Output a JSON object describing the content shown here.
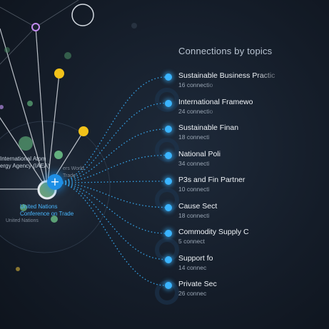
{
  "panel": {
    "title": "Connections by topics"
  },
  "topics": [
    {
      "label": "Sustainable Business Practic",
      "count": "16 connectio"
    },
    {
      "label": "International Framewo",
      "count": "24 connectio"
    },
    {
      "label": "Sustainable Finan",
      "count": "18 connecti"
    },
    {
      "label": "National Poli",
      "count": "34 connecti"
    },
    {
      "label": "P3s and Fin Partner",
      "count": "10 connecti"
    },
    {
      "label": "Cause Sect",
      "count": "18 connecti"
    },
    {
      "label": "Commodity Supply C",
      "count": "5 connect"
    },
    {
      "label": "Support fo",
      "count": "14 connec"
    },
    {
      "label": "Private Sec",
      "count": "26 connec"
    }
  ],
  "graph": {
    "hub_button": "+",
    "node_labels": {
      "iaea": "International Atom\nergy Agency (IAEA)",
      "world_trade": "ers World\nTrade",
      "unctad": "United Nations\nConference on Trade",
      "un": "United Nations"
    }
  },
  "colors": {
    "accent_blue": "#3ab4ff",
    "node_yellow": "#f2c21a",
    "node_green": "#5fb07a",
    "node_purple": "#c48cf0",
    "background": "#141c28"
  }
}
